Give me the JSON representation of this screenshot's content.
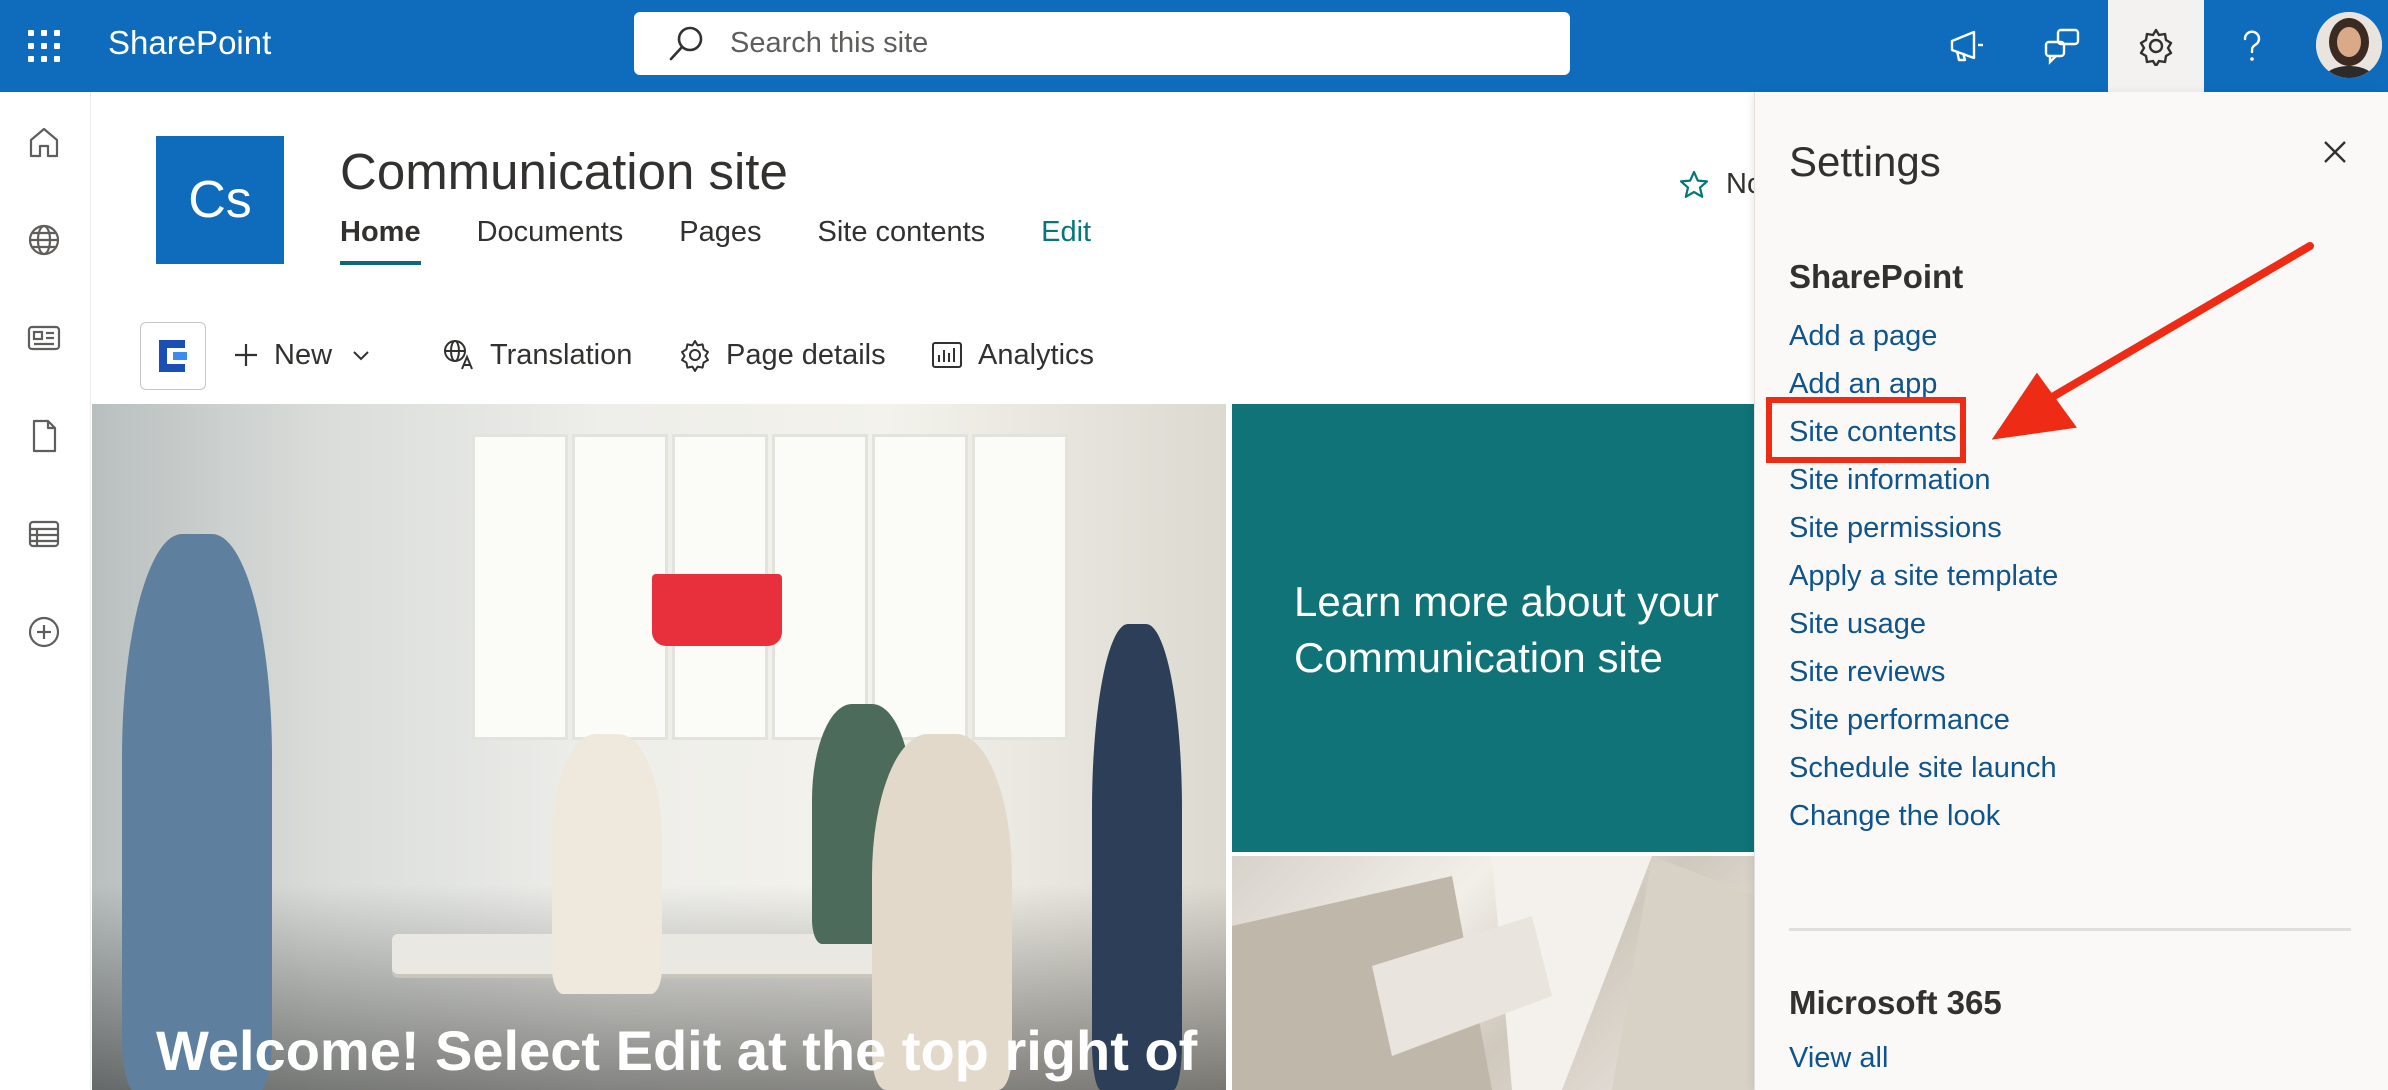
{
  "topbar": {
    "brand": "SharePoint",
    "search_placeholder": "Search this site",
    "accent": "#0f6cbd"
  },
  "site": {
    "logo_text": "Cs",
    "title": "Communication site",
    "nav": [
      {
        "label": "Home"
      },
      {
        "label": "Documents"
      },
      {
        "label": "Pages"
      },
      {
        "label": "Site contents"
      },
      {
        "label": "Edit"
      }
    ],
    "follow_label": "No"
  },
  "commandbar": {
    "new_label": "New",
    "translation_label": "Translation",
    "page_details_label": "Page details",
    "analytics_label": "Analytics"
  },
  "hero": {
    "welcome_text": "Welcome! Select Edit at the top right of",
    "tile_text": "Learn more about your Communication site",
    "tile_color": "#0f7378"
  },
  "settings": {
    "title": "Settings",
    "sharepoint_heading": "SharePoint",
    "links": [
      "Add a page",
      "Add an app",
      "Site contents",
      "Site information",
      "Site permissions",
      "Apply a site template",
      "Site usage",
      "Site reviews",
      "Site performance",
      "Schedule site launch",
      "Change the look"
    ],
    "m365_heading": "Microsoft 365",
    "view_all": "View all",
    "highlighted_link": "Site contents",
    "highlight_color": "#ee2b14"
  }
}
